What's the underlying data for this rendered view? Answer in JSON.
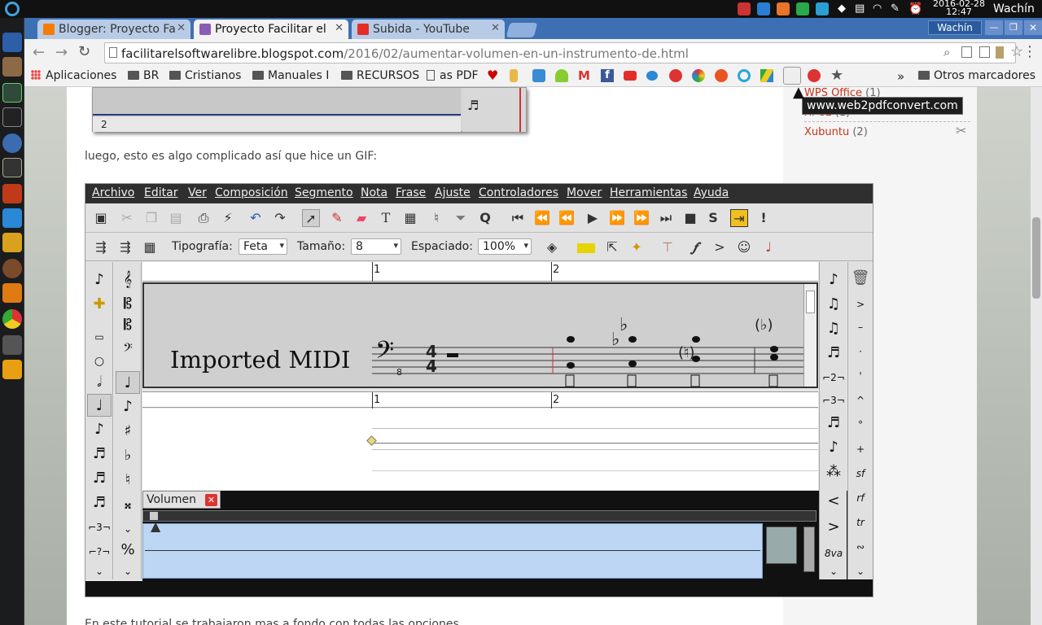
{
  "desktop": {
    "date": "2016-02-28",
    "time": "12:47",
    "user": "Wachín",
    "dock_icons": [
      "menu-icon",
      "mail-icon",
      "books-icon",
      "monitor-icon",
      "terminal-icon",
      "globe-icon",
      "pen-icon",
      "tools-icon",
      "download-icon",
      "teapot-icon",
      "drop-icon",
      "fire-icon",
      "chrome-icon",
      "devil-icon",
      "fire-alt-icon"
    ]
  },
  "browser": {
    "tabs": [
      {
        "label": "Blogger: Proyecto Fa",
        "favicon_color": "#f57c00"
      },
      {
        "label": "Proyecto Facilitar el",
        "favicon_color": "#8a5bb5"
      },
      {
        "label": "Subida - YouTube",
        "favicon_color": "#e52d27"
      }
    ],
    "window_user": "Wachín",
    "url_host": "facilitarelsoftwarelibre.blogspot.com",
    "url_path": "/2016/02/aumentar-volumen-en-un-instrumento-de.html",
    "bookmarks": [
      "Aplicaciones",
      "BR",
      "Cristianos",
      "Manuales I",
      "RECURSOS",
      "as PDF"
    ],
    "bookmark_overflow": "»",
    "other_bookmarks": "Otros marcadores",
    "tooltip": "www.web2pdfconvert.com"
  },
  "blog": {
    "intro_text": "luego, esto es algo complicado así que hice un GIF:",
    "bottom_text": "En este tutorial se trabajaron mas a fondo con todas las opciones...",
    "labels": [
      {
        "name": "WPS Office",
        "count": "(1)"
      },
      {
        "name": "XFCE",
        "count": "(1)"
      },
      {
        "name": "Xubuntu",
        "count": "(2)"
      }
    ],
    "top_screenshot_ruler": "2"
  },
  "rosegarden": {
    "menu": [
      "Archivo",
      "Editar",
      "Ver",
      "Composición",
      "Segmento",
      "Nota",
      "Frase",
      "Ajuste",
      "Controladores",
      "Mover",
      "Herramientas",
      "Ayuda"
    ],
    "typography_label": "Tipografía:",
    "typography_value": "Feta",
    "size_label": "Tamaño:",
    "size_value": "8",
    "spacing_label": "Espaciado:",
    "spacing_value": "100%",
    "track_name": "Imported MIDI",
    "bar_numbers": [
      "1",
      "2"
    ],
    "time_signature": [
      "4",
      "4"
    ],
    "clef_octave": "8",
    "volume_tab": "Volumen",
    "ottava_label": "8va"
  }
}
